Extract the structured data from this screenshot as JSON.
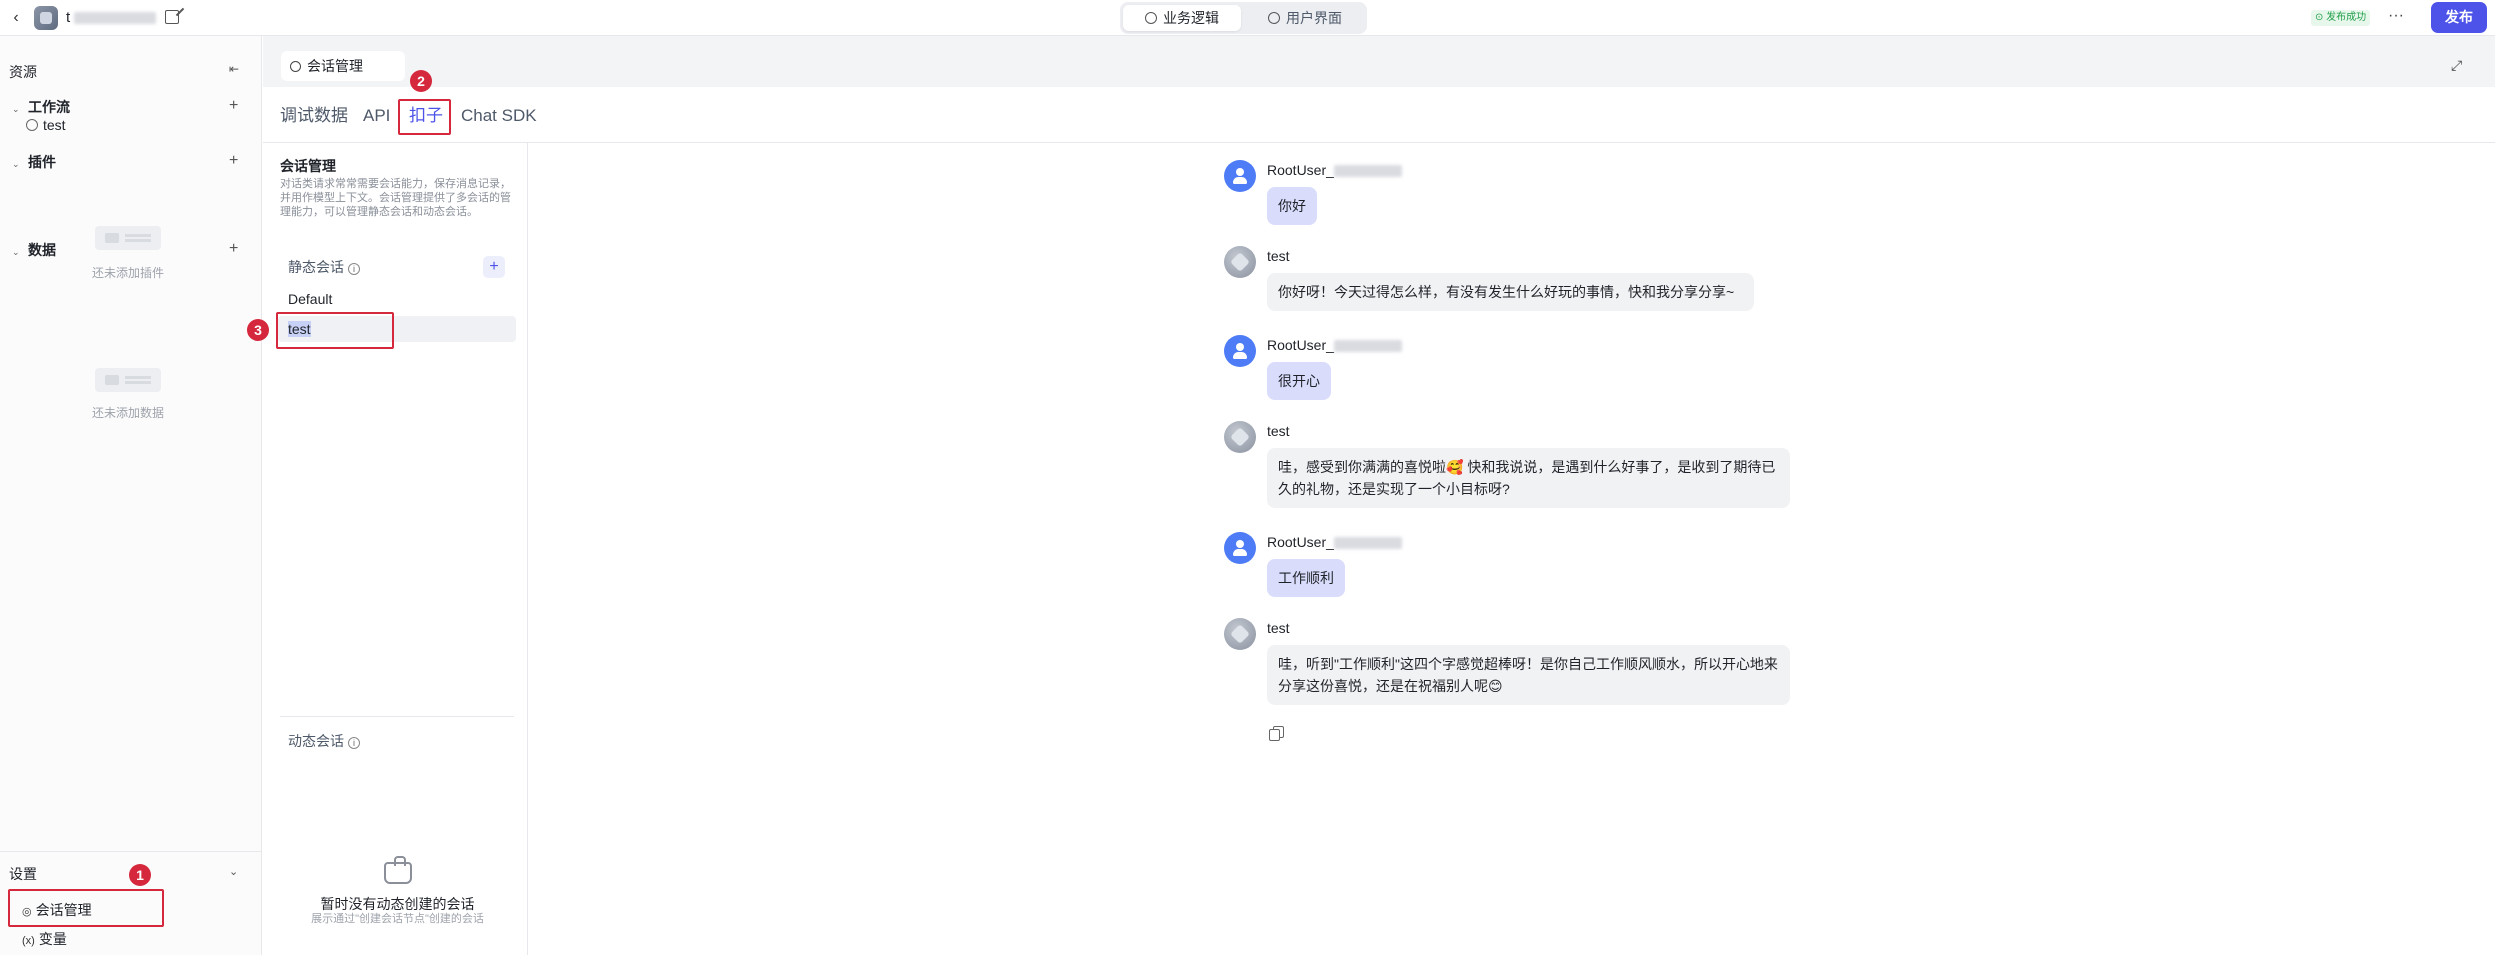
{
  "topbar": {
    "app_name_prefix": "t",
    "modes": [
      "业务逻辑",
      "用户界面"
    ],
    "publish_status": "发布成功",
    "more": "···",
    "publish_label": "发布"
  },
  "sidebar": {
    "title": "资源",
    "sections": {
      "workflow": {
        "label": "工作流",
        "items": [
          "test"
        ]
      },
      "plugins": {
        "label": "插件",
        "empty": "还未添加插件"
      },
      "data": {
        "label": "数据",
        "empty": "还未添加数据"
      }
    },
    "settings": {
      "title": "设置",
      "items": [
        {
          "label": "会话管理",
          "icon": "chat-settings-icon"
        },
        {
          "label": "变量",
          "icon": "(x)"
        }
      ]
    }
  },
  "main": {
    "page_tab": "会话管理",
    "subtabs": [
      "调试数据",
      "API",
      "扣子",
      "Chat SDK"
    ],
    "conv_panel": {
      "title": "会话管理",
      "description": "对话类请求常常需要会话能力，保存消息记录，并用作模型上下文。会话管理提供了多会话的管理能力，可以管理静态会话和动态会话。",
      "static_label": "静态会话",
      "static_items": [
        "Default",
        "test"
      ],
      "dynamic_label": "动态会话",
      "dynamic_empty_title": "暂时没有动态创建的会话",
      "dynamic_empty_sub": "展示通过\"创建会话节点\"创建的会话"
    },
    "chat": [
      {
        "role": "user",
        "sender": "RootUser_",
        "text": "你好"
      },
      {
        "role": "bot",
        "sender": "test",
        "text": "你好呀！今天过得怎么样，有没有发生什么好玩的事情，快和我分享分享~"
      },
      {
        "role": "user",
        "sender": "RootUser_",
        "text": "很开心"
      },
      {
        "role": "bot",
        "sender": "test",
        "text": "哇，感受到你满满的喜悦啦🥰 快和我说说，是遇到什么好事了，是收到了期待已久的礼物，还是实现了一个小目标呀?"
      },
      {
        "role": "user",
        "sender": "RootUser_",
        "text": "工作顺利"
      },
      {
        "role": "bot",
        "sender": "test",
        "text": "哇，听到\"工作顺利\"这四个字感觉超棒呀！是你自己工作顺风顺水，所以开心地来分享这份喜悦，还是在祝福别人呢😊"
      }
    ]
  },
  "annotations": [
    "1",
    "2",
    "3"
  ],
  "colors": {
    "accent": "#4d53e8",
    "annotation": "#d5283c",
    "user_bubble": "#d9dcfb",
    "bot_bubble": "#f1f2f4"
  }
}
